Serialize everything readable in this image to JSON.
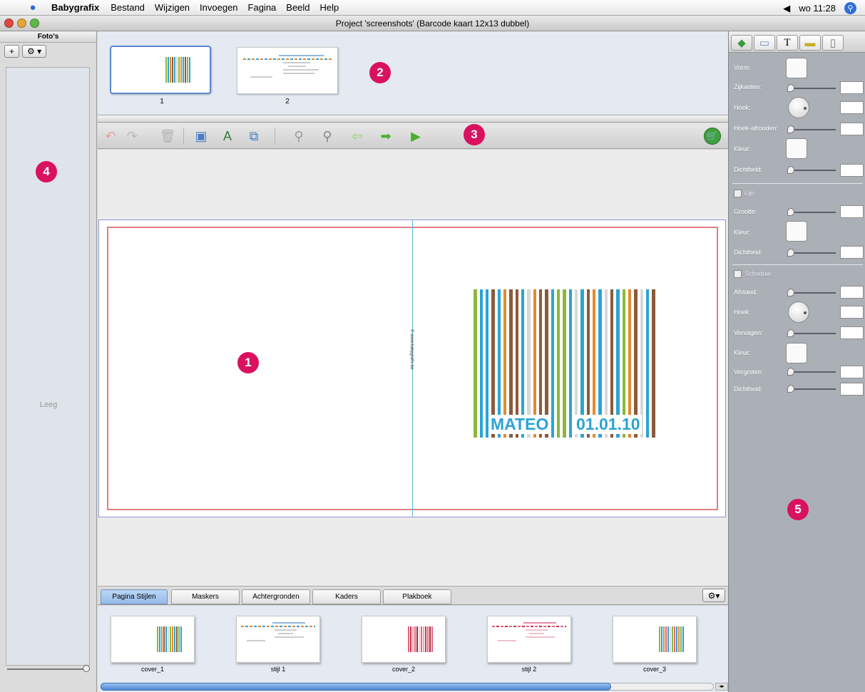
{
  "menubar": {
    "app_name": "Babygrafix",
    "menus": [
      "Bestand",
      "Wijzigen",
      "Invoegen",
      "Fagina",
      "Beeld",
      "Help"
    ],
    "clock": "wo 11:28"
  },
  "window": {
    "title": "Project 'screenshots' (Barcode kaart 12x13 dubbel)"
  },
  "photos_panel": {
    "title": "Foto's",
    "add_label": "+",
    "empty_text": "Leeg"
  },
  "page_thumbs": [
    {
      "label": "1"
    },
    {
      "label": "2"
    }
  ],
  "card": {
    "name": "MATEO",
    "date": "01.01.10",
    "credit": "© www.babygrafix.be"
  },
  "tabs": [
    "Pagina Stijlen",
    "Maskers",
    "Achtergronden",
    "Kaders",
    "Plakboek"
  ],
  "gallery": [
    {
      "label": "cover_1"
    },
    {
      "label": "stijl 1"
    },
    {
      "label": "cover_2"
    },
    {
      "label": "stijl 2"
    },
    {
      "label": "cover_3"
    }
  ],
  "properties": {
    "vorm": "Vorm:",
    "zijkanten": "Zijkanten:",
    "hoek": "Hoek:",
    "hoek_afronden": "Hoek-afronden:",
    "kleur": "Kleur:",
    "dichtheid": "Dichtheid:",
    "lijn": "Lijn",
    "grootte": "Grootte:",
    "schaduw": "Schaduw",
    "afstand": "Afstand:",
    "vervagen": "Vervagen:",
    "vergroten": "Vergroten:"
  },
  "callouts": [
    "1",
    "2",
    "3",
    "4",
    "5"
  ],
  "colors": {
    "accent_blue": "#2ba3d6",
    "callout": "#d9115f",
    "bleed": "#e27e86",
    "fold": "#56b7dc"
  }
}
